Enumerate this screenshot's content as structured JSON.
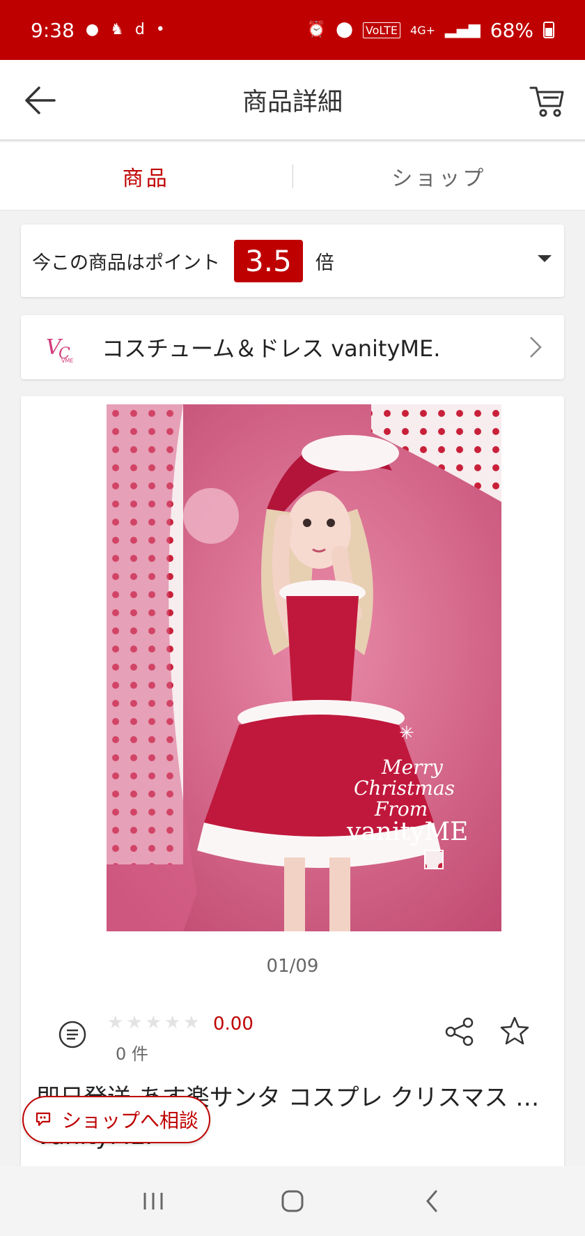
{
  "status_bar": {
    "time": "9:38",
    "battery_text": "68%",
    "network_text": "4G+",
    "volte_text": "VoLTE"
  },
  "header": {
    "title": "商品詳細"
  },
  "tabs": [
    {
      "label": "商品",
      "active": true
    },
    {
      "label": "ショップ",
      "active": false
    }
  ],
  "points": {
    "label": "今この商品はポイント",
    "multiplier": "3.5",
    "suffix": "倍"
  },
  "shop": {
    "name": "コスチューム＆ドレス vanityME.",
    "logo_text": "VME"
  },
  "product": {
    "image_counter": "01/09",
    "photo_caption_lines": [
      "Merry",
      "Christmas",
      "From",
      "vanityME"
    ],
    "rating_value": "0.00",
    "review_count": "0 件",
    "title": "即日発送 あす楽サンタ コスプレ クリスマス … vanityME."
  },
  "consult_button": {
    "label": "ショップへ相談"
  },
  "colors": {
    "brand_red": "#bf0000",
    "star_empty": "#e3e3e3"
  },
  "icons": [
    "back-arrow-icon",
    "cart-icon",
    "dropdown-caret-icon",
    "chevron-right-icon",
    "chat-list-icon",
    "share-icon",
    "star-outline-icon",
    "chat-bubble-icon",
    "recent-apps-icon",
    "home-icon",
    "back-icon"
  ]
}
